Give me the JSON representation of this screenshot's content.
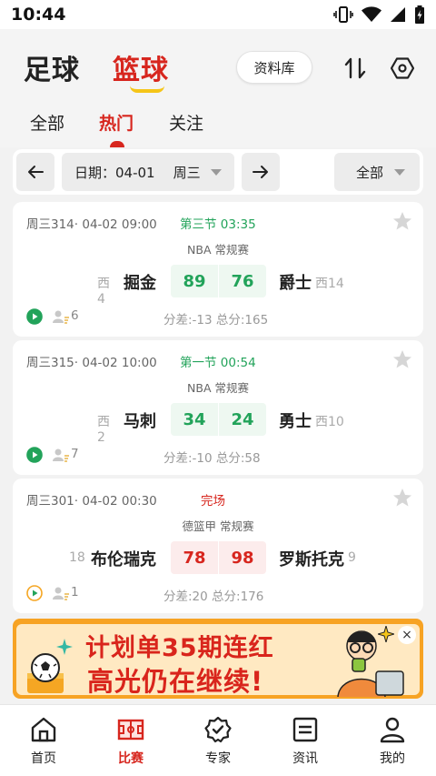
{
  "status_bar": {
    "time": "10:44"
  },
  "header": {
    "sport_tabs": [
      "足球",
      "篮球"
    ],
    "active_sport": "篮球",
    "database_button": "资料库",
    "sub_tabs": [
      "全部",
      "热门",
      "关注"
    ],
    "active_sub_tab": "热门"
  },
  "filter": {
    "date_label": "日期：04-01",
    "weekday": "周三",
    "scope": "全部"
  },
  "matches": [
    {
      "meta": "周三314· 04-02 09:00",
      "status_period": "第三节",
      "status_clock": "03:35",
      "state": "live",
      "league": "NBA 常规赛",
      "home": {
        "rank": "西4",
        "name": "掘金",
        "score": "89"
      },
      "away": {
        "rank": "西14",
        "name": "爵士",
        "score": "76"
      },
      "count": "6",
      "stats": "分差:-13   总分:165",
      "starred": false
    },
    {
      "meta": "周三315· 04-02 10:00",
      "status_period": "第一节",
      "status_clock": "00:54",
      "state": "live",
      "league": "NBA 常规赛",
      "home": {
        "rank": "西2",
        "name": "马刺",
        "score": "34"
      },
      "away": {
        "rank": "西10",
        "name": "勇士",
        "score": "24"
      },
      "count": "7",
      "stats": "分差:-10   总分:58",
      "starred": false
    },
    {
      "meta": "周三301· 04-02 00:30",
      "status_period": "完场",
      "status_clock": "",
      "state": "final",
      "league": "德篮甲 常规赛",
      "home": {
        "rank": "18",
        "name": "布伦瑞克",
        "score": "78"
      },
      "away": {
        "rank": "9",
        "name": "罗斯托克",
        "score": "98"
      },
      "count": "1",
      "stats": "分差:20   总分:176",
      "starred": false
    }
  ],
  "ad": {
    "line1": "计划单35期连红",
    "line2": "高光仍在继续!",
    "close": "×"
  },
  "bottom_nav": [
    {
      "label": "首页",
      "icon": "home-icon"
    },
    {
      "label": "比赛",
      "icon": "court-icon"
    },
    {
      "label": "专家",
      "icon": "expert-badge-icon"
    },
    {
      "label": "资讯",
      "icon": "news-icon"
    },
    {
      "label": "我的",
      "icon": "profile-icon"
    }
  ],
  "active_nav": "比赛",
  "colors": {
    "accent_red": "#d7261e",
    "live_green": "#22a35a",
    "underline_yellow": "#f5c518"
  }
}
